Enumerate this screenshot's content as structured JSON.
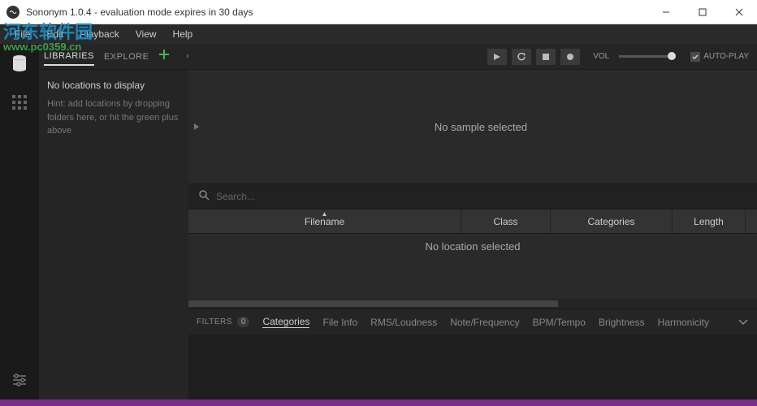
{
  "window": {
    "title": "Sononym 1.0.4 - evaluation mode expires in 30 days"
  },
  "watermark": {
    "text_cn": "河东软件园",
    "url": "www.pc0359.cn"
  },
  "menu": {
    "file": "File",
    "edit": "Edit",
    "playback": "Playback",
    "view": "View",
    "help": "Help"
  },
  "sidebar": {
    "tabs": {
      "libraries": "LIBRARIES",
      "explore": "EXPLORE"
    },
    "heading": "No locations to display",
    "hint": "Hint: add locations by dropping folders here, or hit the green plus above"
  },
  "player": {
    "vol_label": "VOL",
    "autoplay_label": "AUTO-PLAY"
  },
  "preview": {
    "message": "No sample selected"
  },
  "search": {
    "placeholder": "Search..."
  },
  "table": {
    "columns": {
      "filename": "Filename",
      "class": "Class",
      "categories": "Categories",
      "length": "Length"
    },
    "empty_message": "No location selected"
  },
  "filters": {
    "label": "FILTERS",
    "count": "0",
    "tabs": {
      "categories": "Categories",
      "fileinfo": "File Info",
      "rms": "RMS/Loudness",
      "note": "Note/Frequency",
      "bpm": "BPM/Tempo",
      "brightness": "Brightness",
      "harmonicity": "Harmonicity"
    }
  }
}
